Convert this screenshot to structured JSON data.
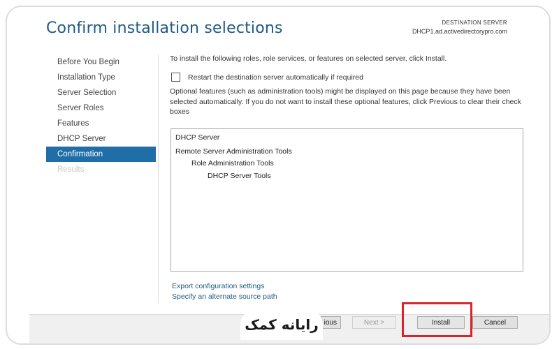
{
  "header": {
    "title": "Confirm installation selections",
    "destination_label": "DESTINATION SERVER",
    "destination_value": "DHCP1.ad.activedirectorypro.com"
  },
  "nav": {
    "items": [
      {
        "label": "Before You Begin",
        "state": "normal"
      },
      {
        "label": "Installation Type",
        "state": "normal"
      },
      {
        "label": "Server Selection",
        "state": "normal"
      },
      {
        "label": "Server Roles",
        "state": "normal"
      },
      {
        "label": "Features",
        "state": "normal"
      },
      {
        "label": "DHCP Server",
        "state": "normal"
      },
      {
        "label": "Confirmation",
        "state": "active"
      },
      {
        "label": "Results",
        "state": "disabled"
      }
    ]
  },
  "main": {
    "intro": "To install the following roles, role services, or features on selected server, click Install.",
    "restart_label": "Restart the destination server automatically if required",
    "restart_checked": false,
    "optional_text": "Optional features (such as administration tools) might be displayed on this page because they have been selected automatically. If you do not want to install these optional features, click Previous to clear their check boxes",
    "features": [
      {
        "label": "DHCP Server",
        "level": 0
      },
      {
        "label": "Remote Server Administration Tools",
        "level": 0
      },
      {
        "label": "Role Administration Tools",
        "level": 1
      },
      {
        "label": "DHCP Server Tools",
        "level": 2
      }
    ],
    "export_link": "Export configuration settings",
    "alternate_link": "Specify an alternate source path"
  },
  "footer": {
    "previous_label": "< Previous",
    "previous_visible": "ious",
    "next_label": "Next >",
    "install_label": "Install",
    "cancel_label": "Cancel"
  },
  "watermark": {
    "text": "رایانه کمک"
  },
  "colors": {
    "accent": "#1f6ea8",
    "title": "#1f5a87",
    "highlight": "#d9242c"
  }
}
